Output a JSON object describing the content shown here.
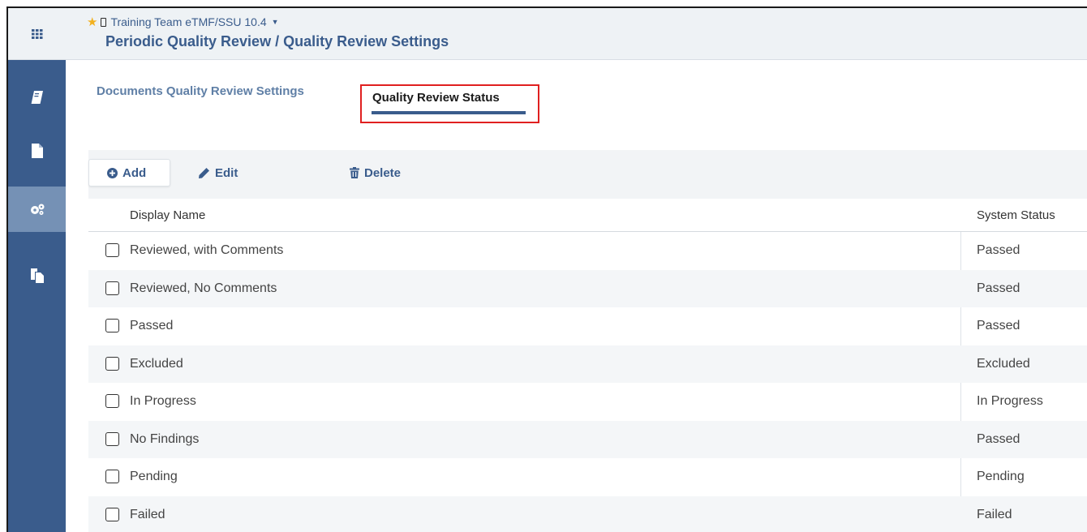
{
  "header": {
    "app_name": "Training Team eTMF/SSU 10.4",
    "title": "Periodic Quality Review / Quality Review Settings"
  },
  "sidebar": {
    "items": [
      {
        "icon": "apps-grid-icon"
      },
      {
        "icon": "book-icon"
      },
      {
        "icon": "document-icon"
      },
      {
        "icon": "gears-icon",
        "active": true
      },
      {
        "icon": "copy-documents-icon"
      }
    ]
  },
  "tabs": {
    "settings": "Documents Quality Review Settings",
    "status": "Quality Review Status"
  },
  "toolbar": {
    "add": "Add",
    "edit": "Edit",
    "delete": "Delete"
  },
  "table": {
    "headers": [
      "Display Name",
      "System Status"
    ],
    "rows": [
      {
        "display_name": "Reviewed, with Comments",
        "system_status": "Passed"
      },
      {
        "display_name": "Reviewed, No Comments",
        "system_status": "Passed"
      },
      {
        "display_name": "Passed",
        "system_status": "Passed"
      },
      {
        "display_name": "Excluded",
        "system_status": "Excluded"
      },
      {
        "display_name": "In Progress",
        "system_status": "In Progress"
      },
      {
        "display_name": "No Findings",
        "system_status": "Passed"
      },
      {
        "display_name": "Pending",
        "system_status": "Pending"
      },
      {
        "display_name": "Failed",
        "system_status": "Failed"
      }
    ]
  },
  "colors": {
    "brand": "#3a5c8c",
    "highlight": "#e02020",
    "star": "#f2b11f"
  }
}
